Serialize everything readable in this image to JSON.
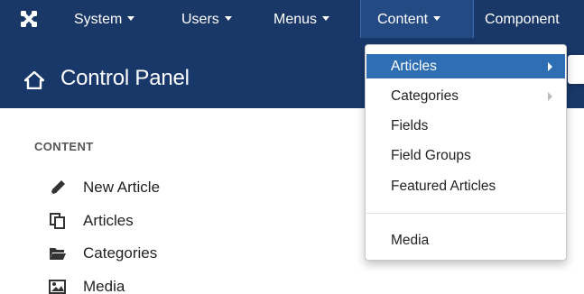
{
  "navbar": {
    "items": [
      {
        "label": "System"
      },
      {
        "label": "Users"
      },
      {
        "label": "Menus"
      },
      {
        "label": "Content"
      },
      {
        "label": "Component"
      }
    ]
  },
  "header": {
    "title": "Control Panel"
  },
  "content_panel": {
    "section_title": "CONTENT",
    "items": [
      {
        "label": "New Article",
        "icon": "pencil-icon"
      },
      {
        "label": "Articles",
        "icon": "copy-icon"
      },
      {
        "label": "Categories",
        "icon": "folder-open-icon"
      },
      {
        "label": "Media",
        "icon": "image-icon"
      }
    ]
  },
  "content_menu": {
    "items": [
      {
        "label": "Articles"
      },
      {
        "label": "Categories"
      },
      {
        "label": "Fields"
      },
      {
        "label": "Field Groups"
      },
      {
        "label": "Featured Articles"
      },
      {
        "label": "Media"
      }
    ]
  },
  "colors": {
    "navbar_bg": "#1a3867",
    "header_bg": "#19386a",
    "menu_active": "#2d6fb2"
  }
}
